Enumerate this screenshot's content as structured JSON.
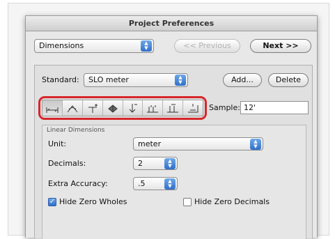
{
  "window": {
    "title": "Project Preferences"
  },
  "category": {
    "selected": "Dimensions"
  },
  "nav": {
    "previous_label": "<< Previous",
    "next_label": "Next >>"
  },
  "standard": {
    "label": "Standard:",
    "selected": "SLO meter",
    "add_label": "Add...",
    "delete_label": "Delete"
  },
  "toolbar": {
    "icons": [
      {
        "name": "linear-dimension-icon",
        "active": true
      },
      {
        "name": "angular-dimension-icon",
        "active": false
      },
      {
        "name": "radial-dimension-icon",
        "active": false
      },
      {
        "name": "level-dimension-icon",
        "active": false
      },
      {
        "name": "elevation-dimension-icon",
        "active": false
      },
      {
        "name": "door-window-dimension-icon",
        "active": false
      },
      {
        "name": "sill-height-dimension-icon",
        "active": false
      },
      {
        "name": "area-dimension-icon",
        "active": false
      }
    ],
    "highlight_color": "#d7262b"
  },
  "sample": {
    "label": "Sample:",
    "value": "12'"
  },
  "linear": {
    "title": "Linear Dimensions",
    "unit_label": "Unit:",
    "unit_value": "meter",
    "decimals_label": "Decimals:",
    "decimals_value": "2",
    "accuracy_label": "Extra Accuracy:",
    "accuracy_value": ".5",
    "hide_zero_wholes_label": "Hide Zero Wholes",
    "hide_zero_wholes_checked": true,
    "hide_zero_decimals_label": "Hide Zero Decimals",
    "hide_zero_decimals_checked": false
  },
  "colors": {
    "accent": "#2f6fc9",
    "highlight": "#d7262b"
  }
}
